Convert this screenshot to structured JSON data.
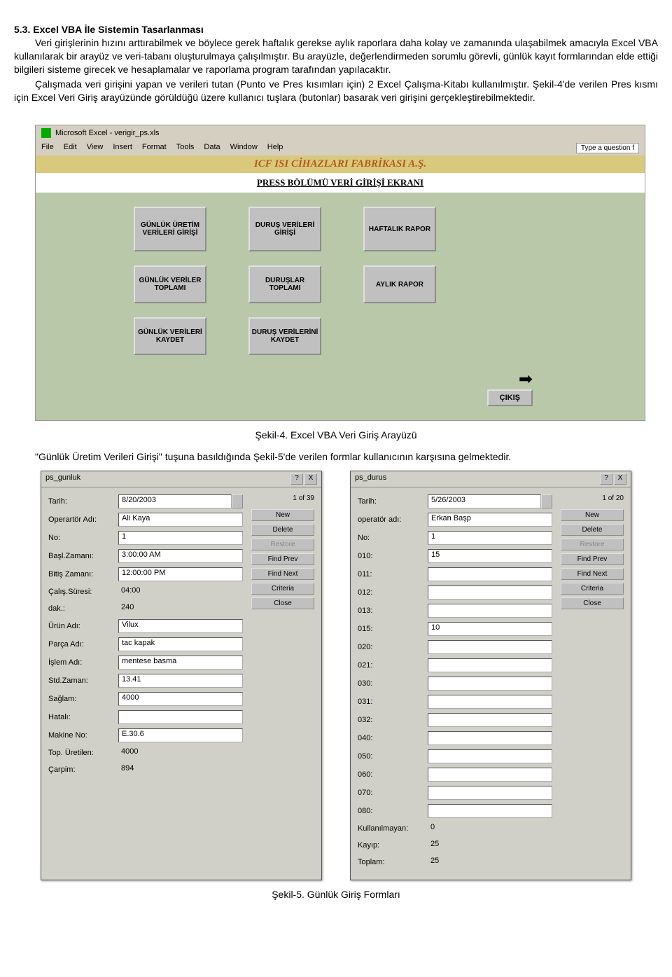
{
  "section_title": "5.3. Excel VBA İle Sistemin Tasarlanması",
  "para1": "Veri girişlerinin hızını arttırabilmek ve böylece gerek haftalık gerekse aylık raporlara daha kolay ve zamanında ulaşabilmek amacıyla Excel VBA kullanılarak bir arayüz ve veri-tabanı oluşturulmaya çalışılmıştır. Bu arayüzle, değerlendirmeden sorumlu görevli, günlük kayıt formlarından elde ettiği bilgileri sisteme girecek ve  hesaplamalar ve raporlama program tarafından yapılacaktır.",
  "para2": "Çalışmada veri girişini yapan ve verileri tutan (Punto ve Pres kısımları için)  2 Excel Çalışma-Kitabı kullanılmıştır. Şekil-4'de verilen Pres kısmı için Excel Veri Giriş arayüzünde görüldüğü üzere kullanıcı tuşlara (butonlar) basarak veri girişini gerçekleştirebilmektedir.",
  "excel_title": "Microsoft Excel - verigir_ps.xls",
  "menu": {
    "file": "File",
    "edit": "Edit",
    "view": "View",
    "insert": "Insert",
    "format": "Format",
    "tools": "Tools",
    "data": "Data",
    "window": "Window",
    "help": "Help"
  },
  "help_placeholder": "Type a question f",
  "company": "ICF ISI CİHAZLARI FABRİKASI A.Ş.",
  "screen_title": "PRESS BÖLÜMÜ VERİ GİRİŞİ EKRANI",
  "buttons": {
    "r1c1": "GÜNLÜK ÜRETİM VERİLERİ GİRİŞİ",
    "r1c2": "DURUŞ VERİLERİ GİRİŞİ",
    "r1c3": "HAFTALIK RAPOR",
    "r2c1": "GÜNLÜK VERİLER TOPLAMI",
    "r2c2": "DURUŞLAR TOPLAMI",
    "r2c3": "AYLIK RAPOR",
    "r3c1": "GÜNLÜK VERİLERİ KAYDET",
    "r3c2": "DURUŞ VERİLERİNİ KAYDET",
    "cikis": "ÇIKIŞ"
  },
  "caption4": "Şekil-4. Excel VBA Veri Giriş Arayüzü",
  "para3": "\"Günlük Üretim Verileri Girişi\" tuşuna basıldığında Şekil-5'de verilen formlar kullanıcının karşısına gelmektedir.",
  "dialog_left": {
    "title": "ps_gunluk",
    "counter": "1 of 39",
    "fields": [
      {
        "label": "Tarih:",
        "value": "8/20/2003",
        "spinner": true
      },
      {
        "label": "Operartör Adı:",
        "value": "Ali Kaya"
      },
      {
        "label": "No:",
        "value": "1"
      },
      {
        "label": "Başl.Zamanı:",
        "value": "3:00:00 AM"
      },
      {
        "label": "Bitiş Zamanı:",
        "value": "12:00:00 PM"
      },
      {
        "label": "Çalış.Süresi:",
        "value": "04:00",
        "readonly": true
      },
      {
        "label": "dak.:",
        "value": "240",
        "readonly": true
      },
      {
        "label": "Ürün Adı:",
        "value": "Vilux"
      },
      {
        "label": "Parça Adı:",
        "value": "tac kapak"
      },
      {
        "label": "İşlem Adı:",
        "value": "mentese basma"
      },
      {
        "label": "Std.Zaman:",
        "value": "13.41"
      },
      {
        "label": "Sağlam:",
        "value": "4000"
      },
      {
        "label": "Hatalı:",
        "value": ""
      },
      {
        "label": "Makine No:",
        "value": "E.30.6"
      },
      {
        "label": "Top. Üretilen:",
        "value": "4000",
        "readonly": true
      },
      {
        "label": "Çarpim:",
        "value": "894",
        "readonly": true
      }
    ],
    "buttons": [
      "New",
      "Delete",
      "Restore",
      "Find Prev",
      "Find Next",
      "Criteria",
      "Close"
    ]
  },
  "dialog_right": {
    "title": "ps_durus",
    "counter": "1 of 20",
    "fields": [
      {
        "label": "Tarih:",
        "value": "5/26/2003",
        "spinner": true
      },
      {
        "label": "operatör adı:",
        "value": "Erkan Başp"
      },
      {
        "label": "No:",
        "value": "1"
      },
      {
        "label": "010:",
        "value": "15"
      },
      {
        "label": "011:",
        "value": ""
      },
      {
        "label": "012:",
        "value": ""
      },
      {
        "label": "013:",
        "value": ""
      },
      {
        "label": "015:",
        "value": "10"
      },
      {
        "label": "020:",
        "value": ""
      },
      {
        "label": "021:",
        "value": ""
      },
      {
        "label": "030:",
        "value": ""
      },
      {
        "label": "031:",
        "value": ""
      },
      {
        "label": "032:",
        "value": ""
      },
      {
        "label": "040:",
        "value": ""
      },
      {
        "label": "050:",
        "value": ""
      },
      {
        "label": "060:",
        "value": ""
      },
      {
        "label": "070:",
        "value": ""
      },
      {
        "label": "080:",
        "value": ""
      },
      {
        "label": "Kullanılmayan:",
        "value": "0",
        "readonly": true
      },
      {
        "label": "Kayıp:",
        "value": "25",
        "readonly": true
      },
      {
        "label": "Toplam:",
        "value": "25",
        "readonly": true
      }
    ],
    "buttons": [
      "New",
      "Delete",
      "Restore",
      "Find Prev",
      "Find Next",
      "Criteria",
      "Close"
    ]
  },
  "caption5": "Şekil-5. Günlük Giriş Formları"
}
